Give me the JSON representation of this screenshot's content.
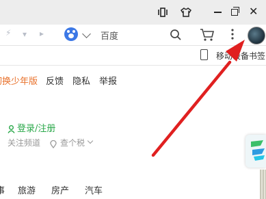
{
  "address_bar": {
    "search_text": "百度",
    "search_engine_icon": "baidu-paw-icon"
  },
  "bookmarks": {
    "mobile_bookmarks_label": "移动设备书签"
  },
  "page": {
    "top_links": [
      "切换少年版",
      "反馈",
      "隐私",
      "举报"
    ],
    "login_label": "登录/注册",
    "followed_channels": "关注频道",
    "tax_lookup": "查个税",
    "categories": [
      "事",
      "旅游",
      "房产",
      "汽车"
    ]
  },
  "colors": {
    "arrow": "#e02020",
    "login_green": "#2aa84a",
    "top_link_orange": "#e8702a",
    "baidu_blue": "#3c78e6"
  }
}
